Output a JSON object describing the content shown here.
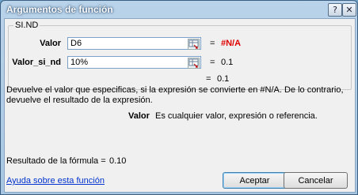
{
  "window": {
    "title": "Argumentos de función",
    "help_button": "?",
    "close_button": "✕"
  },
  "group": {
    "legend": "SI.ND",
    "args": [
      {
        "label": "Valor",
        "value": "D6",
        "result": "#N/A"
      },
      {
        "label": "Valor_si_nd",
        "value": "10%",
        "result": "0.1"
      }
    ],
    "eq": "=",
    "overall_result": "0.1"
  },
  "description": {
    "line1": "Devuelve el valor que especificas, si la expresión se convierte en #N/A. De lo contrario,",
    "line2": "devuelve el resultado de la expresión."
  },
  "arg_help": {
    "name": "Valor",
    "text": "Es cualquier valor, expresión o referencia."
  },
  "formula_result": {
    "label": "Resultado de la fórmula =",
    "value": "0.10"
  },
  "footer": {
    "help_link": "Ayuda sobre esta función",
    "ok_label": "Aceptar",
    "cancel_label": "Cancelar"
  },
  "colors": {
    "error_result": "#e00000",
    "link": "#0033cc"
  }
}
